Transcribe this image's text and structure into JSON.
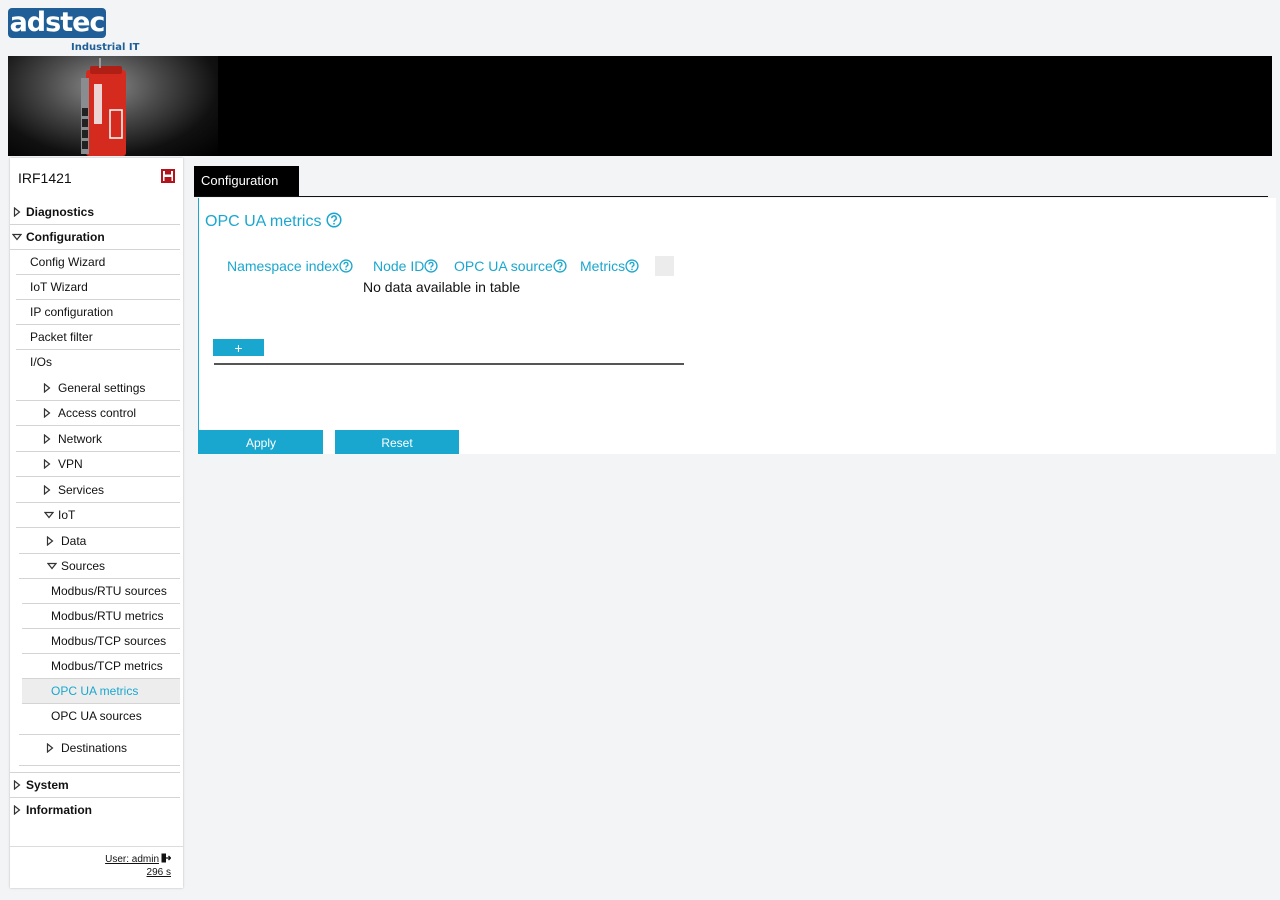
{
  "header": {
    "logo_text": "adstec",
    "logo_subtitle": "Industrial IT"
  },
  "sidebar": {
    "device_name": "IRF1421",
    "items": [
      {
        "label": "Diagnostics",
        "state": "collapsed"
      },
      {
        "label": "Configuration",
        "state": "expanded"
      },
      {
        "label": "Config Wizard"
      },
      {
        "label": "IoT Wizard"
      },
      {
        "label": "IP configuration"
      },
      {
        "label": "Packet filter"
      },
      {
        "label": "I/Os"
      },
      {
        "label": "General settings",
        "state": "collapsed"
      },
      {
        "label": "Access control",
        "state": "collapsed"
      },
      {
        "label": "Network",
        "state": "collapsed"
      },
      {
        "label": "VPN",
        "state": "collapsed"
      },
      {
        "label": "Services",
        "state": "collapsed"
      },
      {
        "label": "IoT",
        "state": "expanded"
      },
      {
        "label": "Data",
        "state": "collapsed"
      },
      {
        "label": "Sources",
        "state": "expanded"
      },
      {
        "label": "Modbus/RTU sources"
      },
      {
        "label": "Modbus/RTU metrics"
      },
      {
        "label": "Modbus/TCP sources"
      },
      {
        "label": "Modbus/TCP metrics"
      },
      {
        "label": "OPC UA metrics",
        "active": true
      },
      {
        "label": "OPC UA sources"
      },
      {
        "label": "Destinations",
        "state": "collapsed"
      },
      {
        "label": "System",
        "state": "collapsed"
      },
      {
        "label": "Information",
        "state": "collapsed"
      }
    ],
    "footer": {
      "user": "User: admin",
      "timer": "296 s"
    }
  },
  "tabs": [
    {
      "label": "Configuration",
      "active": true
    }
  ],
  "main": {
    "title": "OPC UA metrics",
    "table": {
      "columns": [
        "Namespace index",
        "Node ID",
        "OPC UA source",
        "Metrics"
      ],
      "empty_message": "No data available in table"
    },
    "add_label": "+",
    "apply_label": "Apply",
    "reset_label": "Reset"
  },
  "colors": {
    "accent": "#1aa7cf",
    "brand": "#1f5e97",
    "save_icon": "#b3141c"
  }
}
